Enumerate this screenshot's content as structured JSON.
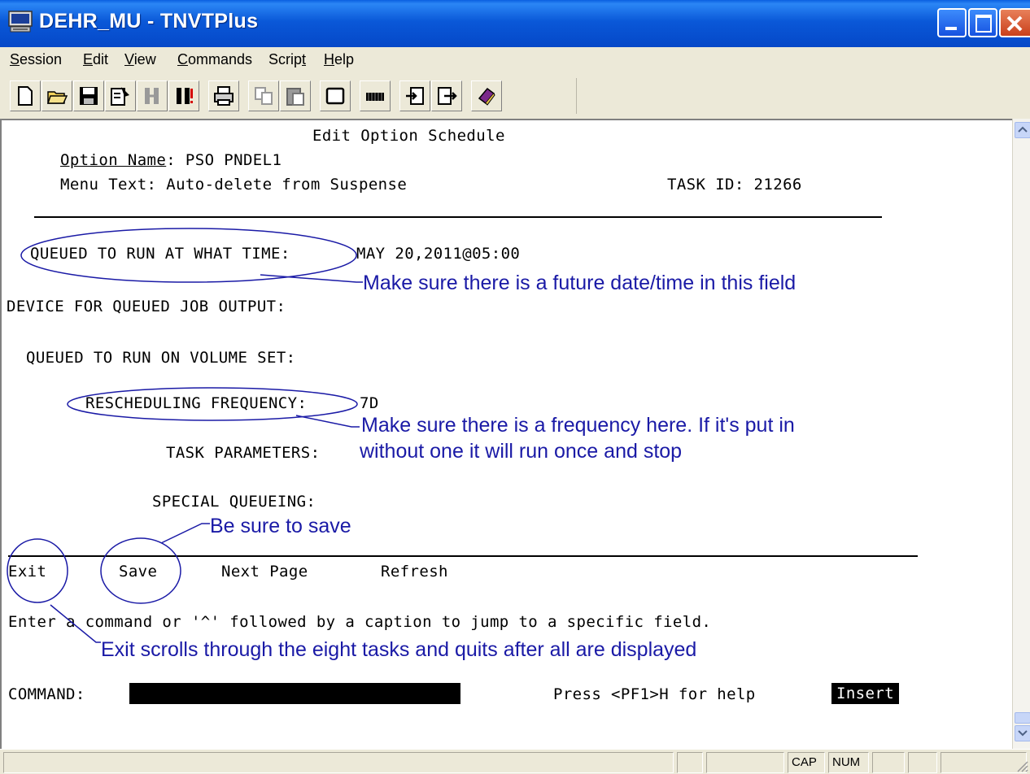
{
  "window": {
    "title": "DEHR_MU - TNVTPlus"
  },
  "menu": {
    "items": [
      {
        "label": "Session",
        "underline": "S"
      },
      {
        "label": "Edit",
        "underline": "E"
      },
      {
        "label": "View",
        "underline": "V"
      },
      {
        "label": "Commands",
        "underline": "C"
      },
      {
        "label": "Script",
        "underline": "t"
      },
      {
        "label": "Help",
        "underline": "H"
      }
    ]
  },
  "toolbar": {
    "icons": [
      "new-document-icon",
      "open-folder-icon",
      "save-disk-icon",
      "properties-icon",
      "disconnect-icon",
      "connect-icon",
      "print-icon",
      "copy-icon",
      "paste-icon",
      "screen-icon",
      "keyboard-icon",
      "import-icon",
      "export-icon",
      "book-icon"
    ]
  },
  "terminal": {
    "heading": "Edit Option Schedule",
    "option_name_label": "Option Name",
    "option_name_value": ": PSO PNDEL1",
    "menu_text": "Menu Text: Auto-delete from Suspense",
    "task_id": "TASK ID: 21266",
    "queued_time_label": "QUEUED TO RUN AT WHAT TIME:",
    "queued_time_value": "MAY 20,2011@05:00",
    "device_label": "DEVICE FOR QUEUED JOB OUTPUT:",
    "volume_label": "QUEUED TO RUN ON VOLUME SET:",
    "resched_label": "RESCHEDULING FREQUENCY:",
    "resched_value": "7D",
    "task_params_label": "TASK PARAMETERS:",
    "special_label": "SPECIAL QUEUEING:",
    "cmd_exit": "Exit",
    "cmd_save": "Save",
    "cmd_next": "Next Page",
    "cmd_refresh": "Refresh",
    "instruction": "Enter a command or '^' followed by a caption to jump to a specific field.",
    "command_label": "COMMAND:",
    "help_text": "Press <PF1>H for help",
    "mode": "Insert"
  },
  "annotations": {
    "future_date": "Make sure there is a future date/time in this field",
    "frequency_line1": "Make sure there is a frequency here. If it's put in",
    "frequency_line2": "without one it will run once and stop",
    "save_note": "Be sure to save",
    "exit_note": "Exit scrolls through the eight tasks and quits after all are displayed",
    "color": "#1a1aa6"
  },
  "statusbar": {
    "cap": "CAP",
    "num": "NUM"
  }
}
